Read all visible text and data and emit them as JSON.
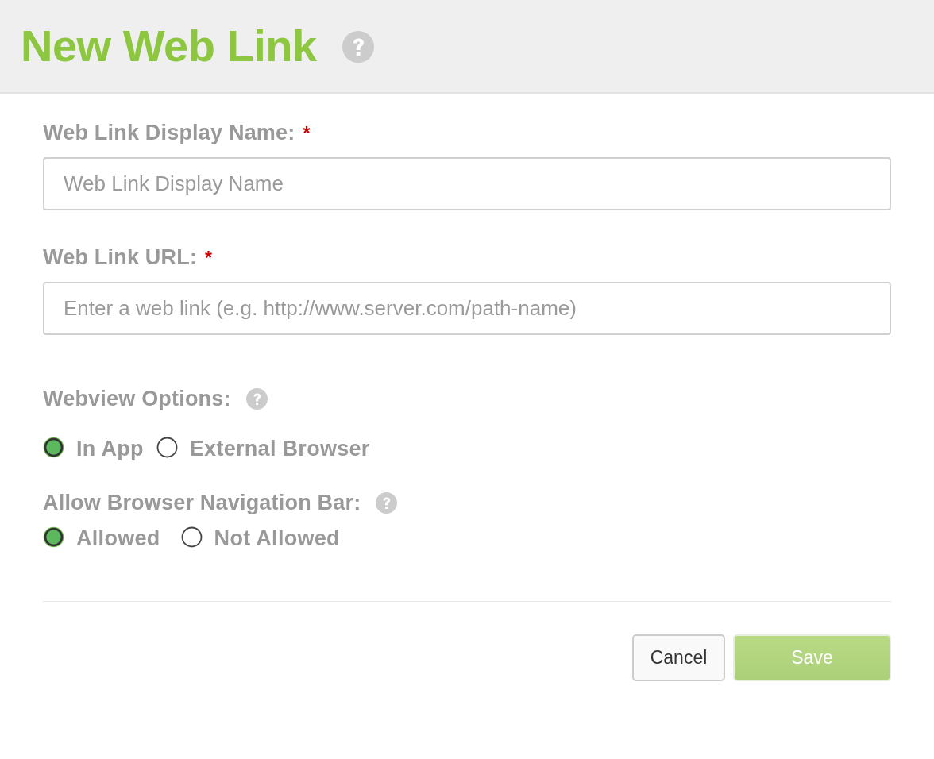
{
  "header": {
    "title": "New Web Link"
  },
  "fields": [
    {
      "label": "Web Link Display Name:",
      "required_mark": "*",
      "placeholder": "Web Link Display Name"
    },
    {
      "label": "Web Link URL:",
      "required_mark": "*",
      "placeholder": "Enter a web link (e.g. http://www.server.com/path-name)"
    }
  ],
  "option_groups": [
    {
      "label": "Webview Options:",
      "options": [
        {
          "label": "In App",
          "selected": true
        },
        {
          "label": "External Browser",
          "selected": false
        }
      ]
    },
    {
      "label": "Allow Browser Navigation Bar:",
      "options": [
        {
          "label": "Allowed",
          "selected": true
        },
        {
          "label": "Not Allowed",
          "selected": false
        }
      ]
    }
  ],
  "buttons": [
    {
      "label": "Cancel",
      "kind": "secondary",
      "disabled": false
    },
    {
      "label": "Save",
      "kind": "primary",
      "disabled": true
    }
  ]
}
